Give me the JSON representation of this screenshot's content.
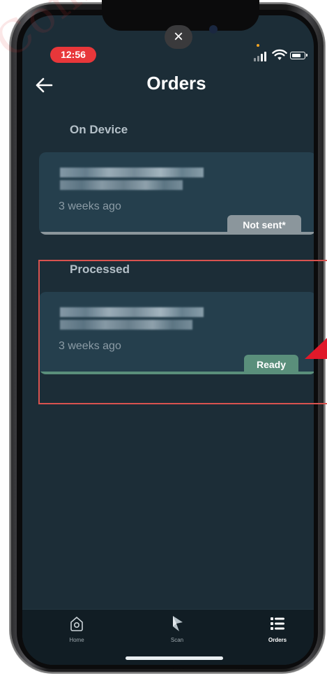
{
  "status_bar": {
    "time": "12:56"
  },
  "header": {
    "title": "Orders",
    "close_glyph": "×"
  },
  "sections": {
    "on_device": {
      "label": "On Device",
      "order": {
        "timestamp": "3 weeks ago",
        "status": "Not sent*",
        "status_color": "#8b969c"
      }
    },
    "processed": {
      "label": "Processed",
      "order": {
        "timestamp": "3 weeks ago",
        "status": "Ready",
        "status_color": "#5a8f7b"
      }
    }
  },
  "tab_bar": {
    "items": [
      {
        "label": "Home",
        "icon": "home-icon"
      },
      {
        "label": "Scan",
        "icon": "scan-icon"
      },
      {
        "label": "Orders",
        "icon": "orders-list-icon"
      }
    ],
    "active": "Orders"
  },
  "annotations": {
    "highlight_color": "#d9534f",
    "pointer_color": "#e0192a"
  },
  "colors": {
    "screen_background": "#1c2d37",
    "card_background": "#253f4d",
    "tab_bar_background": "#111d24",
    "time_pill": "#e8373a"
  }
}
